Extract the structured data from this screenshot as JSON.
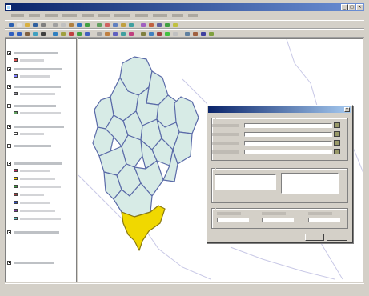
{
  "window": {
    "title": ""
  },
  "menu": [
    "",
    "",
    "",
    "",
    "",
    "",
    "",
    "",
    "",
    "",
    ""
  ],
  "toolbar1": [
    {
      "icon": "app-icon",
      "color": "#2a5fb0"
    },
    {
      "icon": "new-icon",
      "color": "#e0e0e0"
    },
    {
      "icon": "open-icon",
      "color": "#d8b040"
    },
    {
      "icon": "save-icon",
      "color": "#3060a0"
    },
    {
      "icon": "print-icon",
      "color": "#808080"
    },
    {
      "icon": "cut-icon",
      "color": "#a0a0a0"
    },
    {
      "icon": "copy-icon",
      "color": "#c0c0c0"
    },
    {
      "icon": "paste-icon",
      "color": "#b08040"
    },
    {
      "icon": "undo-icon",
      "color": "#3070c0"
    },
    {
      "icon": "add-data-icon",
      "color": "#40a040"
    },
    {
      "icon": "layer-icon",
      "color": "#60a060"
    },
    {
      "icon": "tool-icon",
      "color": "#d06060"
    },
    {
      "icon": "tool-icon",
      "color": "#6080c0"
    },
    {
      "icon": "tool-icon",
      "color": "#c0a040"
    },
    {
      "icon": "tool-icon",
      "color": "#40a0a0"
    },
    {
      "icon": "tool-icon",
      "color": "#a060c0"
    },
    {
      "icon": "tool-icon",
      "color": "#c06040"
    },
    {
      "icon": "tool-icon",
      "color": "#6060a0"
    },
    {
      "icon": "tool-icon",
      "color": "#40a040"
    },
    {
      "icon": "tool-icon",
      "color": "#c0c040"
    }
  ],
  "toolbar2": [
    {
      "icon": "zoom-in-icon",
      "color": "#3060c0"
    },
    {
      "icon": "zoom-out-icon",
      "color": "#3060c0"
    },
    {
      "icon": "pan-icon",
      "color": "#806040"
    },
    {
      "icon": "full-extent-icon",
      "color": "#40a0c0"
    },
    {
      "icon": "select-icon",
      "color": "#404040"
    },
    {
      "icon": "identify-icon",
      "color": "#3080c0"
    },
    {
      "icon": "measure-icon",
      "color": "#a0a040"
    },
    {
      "icon": "tool-icon",
      "color": "#c04040"
    },
    {
      "icon": "tool-icon",
      "color": "#40a040"
    },
    {
      "icon": "tool-icon",
      "color": "#4060c0"
    },
    {
      "icon": "tool-icon",
      "color": "#a0a0a0"
    },
    {
      "icon": "tool-icon",
      "color": "#c08040"
    },
    {
      "icon": "tool-icon",
      "color": "#6060c0"
    },
    {
      "icon": "tool-icon",
      "color": "#40a0a0"
    },
    {
      "icon": "tool-icon",
      "color": "#c04080"
    },
    {
      "icon": "tool-icon",
      "color": "#808040"
    },
    {
      "icon": "tool-icon",
      "color": "#4080c0"
    },
    {
      "icon": "tool-icon",
      "color": "#a04040"
    },
    {
      "icon": "tool-icon",
      "color": "#40c040"
    },
    {
      "icon": "tool-icon",
      "color": "#c0c0c0"
    },
    {
      "icon": "tool-icon",
      "color": "#6080a0"
    },
    {
      "icon": "tool-icon",
      "color": "#a06040"
    },
    {
      "icon": "tool-icon",
      "color": "#4040a0"
    },
    {
      "icon": "tool-icon",
      "color": "#80a040"
    }
  ],
  "toc": {
    "layers": [
      {
        "checked": true,
        "label": ""
      },
      {
        "checked": true,
        "label": ""
      },
      {
        "checked": true,
        "label": ""
      },
      {
        "checked": true,
        "label": ""
      },
      {
        "checked": true,
        "label": ""
      },
      {
        "checked": true,
        "label": ""
      },
      {
        "checked": true,
        "label": ""
      },
      {
        "checked": true,
        "label": ""
      },
      {
        "checked": true,
        "label": ""
      }
    ],
    "symbols": [
      {
        "color": "#e05050",
        "label": ""
      },
      {
        "color": "#8080ff",
        "label": ""
      },
      {
        "color": "#9090a0",
        "label": ""
      },
      {
        "color": "#60a060",
        "label": ""
      },
      {
        "color": "#ffffff",
        "label": ""
      },
      {
        "color": "#c03060",
        "label": ""
      },
      {
        "color": "#ffd000",
        "label": ""
      },
      {
        "color": "#40a040",
        "label": ""
      },
      {
        "color": "#a04040",
        "label": ""
      },
      {
        "color": "#3050c0",
        "label": ""
      },
      {
        "color": "#8040a0",
        "label": ""
      },
      {
        "color": "#60c0c0",
        "label": ""
      }
    ]
  },
  "map": {
    "subbasin_fill": "#d7ebe6",
    "subbasin_stroke": "#5a6aa8",
    "outlet_fill": "#f0d800",
    "river_color": "#c8c8e6"
  },
  "dialog": {
    "title": "",
    "input_frame": {
      "caption": "",
      "fields": [
        {
          "label": "",
          "value": ""
        },
        {
          "label": "",
          "value": ""
        },
        {
          "label": "",
          "value": ""
        },
        {
          "label": "",
          "value": ""
        }
      ]
    },
    "options_frame": {
      "caption": "",
      "text": "",
      "note": ""
    },
    "output_frame": {
      "caption": "",
      "fields": [
        {
          "label": "",
          "value": ""
        },
        {
          "label": "",
          "value": ""
        },
        {
          "label": "",
          "value": ""
        }
      ]
    },
    "buttons": {
      "ok": "",
      "cancel": ""
    }
  },
  "status": {
    "left": "",
    "right": ""
  }
}
